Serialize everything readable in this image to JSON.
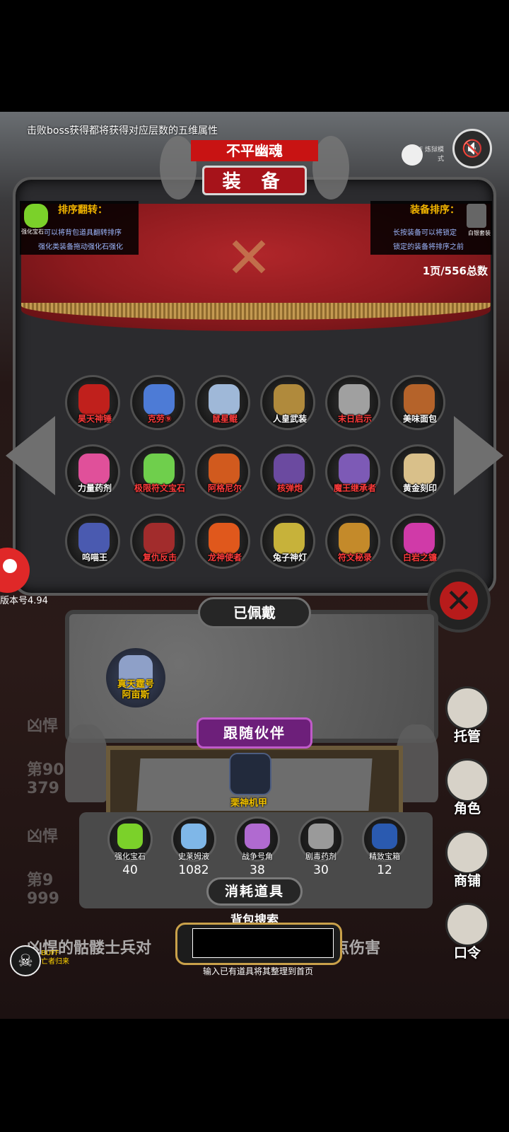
{
  "tip": "击败boss获得都将获得对应层数的五维属性",
  "boss_name": "不平幽魂",
  "title": "装 备",
  "buff_mode_label": "BUFF 炼狱模式",
  "info_left": {
    "gem_label": "强化宝石",
    "heading": "排序翻转：",
    "line1": "可以将背包道具翻转排序",
    "line2": "强化类装备拖动强化石强化"
  },
  "info_right": {
    "set_label": "白银套装",
    "heading": "装备排序：",
    "line1": "长按装备可以将锁定",
    "line2": "锁定的装备将排序之前"
  },
  "page_count": "1页/556总数",
  "items": [
    {
      "label": "昊天神锤",
      "color": "#ff3b3b",
      "art": "#c0201c"
    },
    {
      "label": "克劳⑨",
      "color": "#ff3b3b",
      "art": "#4d7bd6"
    },
    {
      "label": "鼠星鲲",
      "color": "#ff3b3b",
      "art": "#9fb8d8"
    },
    {
      "label": "人皇武装",
      "color": "#ffffff",
      "art": "#b08a3c"
    },
    {
      "label": "末日启示",
      "color": "#ff3b3b",
      "art": "#a0a0a0"
    },
    {
      "label": "美味面包",
      "color": "#ffffff",
      "art": "#b5632a"
    },
    {
      "label": "力量药剂",
      "color": "#ffffff",
      "art": "#e0509a"
    },
    {
      "label": "极限符文宝石",
      "color": "#ff3b3b",
      "art": "#6fcf4c"
    },
    {
      "label": "阿格尼尔",
      "color": "#ff3b3b",
      "art": "#d15a1e"
    },
    {
      "label": "核弹炮",
      "color": "#ff3b3b",
      "art": "#6b4aa0"
    },
    {
      "label": "魔王继承者",
      "color": "#ff3b3b",
      "art": "#7d5ab6"
    },
    {
      "label": "黄金刻印",
      "color": "#ffffff",
      "art": "#d9c08a"
    },
    {
      "label": "呜喵王",
      "color": "#ffffff",
      "art": "#4a5ab0"
    },
    {
      "label": "复仇反击",
      "color": "#ff3b3b",
      "art": "#a22c2c"
    },
    {
      "label": "龙神使者",
      "color": "#ff3b3b",
      "art": "#e0581c"
    },
    {
      "label": "兔子神灯",
      "color": "#ffffff",
      "art": "#c7b23a"
    },
    {
      "label": "符文秘录",
      "color": "#ff3b3b",
      "art": "#c48a2a"
    },
    {
      "label": "白岩之镰",
      "color": "#ff3b3b",
      "art": "#d03aa8"
    }
  ],
  "avatar_label": "",
  "version": "版本号4.94",
  "worn_title": "已佩戴",
  "worn_item": {
    "line1": "真天霆号",
    "line2": "阿亩斯"
  },
  "companion_title": "跟随伙伴",
  "companion_label": "栗神机甲",
  "consumables": [
    {
      "label": "强化宝石",
      "count": "40",
      "art": "#7bd12a"
    },
    {
      "label": "史莱姆液",
      "count": "1082",
      "art": "#7fb7e8"
    },
    {
      "label": "战争号角",
      "count": "38",
      "art": "#b06ad0"
    },
    {
      "label": "剧毒药剂",
      "count": "30",
      "art": "#9a9a9a"
    },
    {
      "label": "精致宝箱",
      "count": "12",
      "art": "#2a5ab0"
    }
  ],
  "consumables_title": "消耗道具",
  "search": {
    "title": "背包搜索",
    "value": "",
    "hint": "输入已有道具将其整理到首页"
  },
  "side_buttons": [
    {
      "label": "托管"
    },
    {
      "label": "角色"
    },
    {
      "label": "商铺"
    },
    {
      "label": "口令"
    }
  ],
  "bg_texts": {
    "t1": "凶悍",
    "t2": "第90",
    "t3": "379",
    "t4": "凶悍",
    "t5": "第9",
    "t6": "999",
    "t7": "凶悍的骷髅士兵对",
    "t8": "点伤害"
  },
  "buff_bottom": {
    "line1": "BUFF",
    "line2": "亡者归来"
  }
}
